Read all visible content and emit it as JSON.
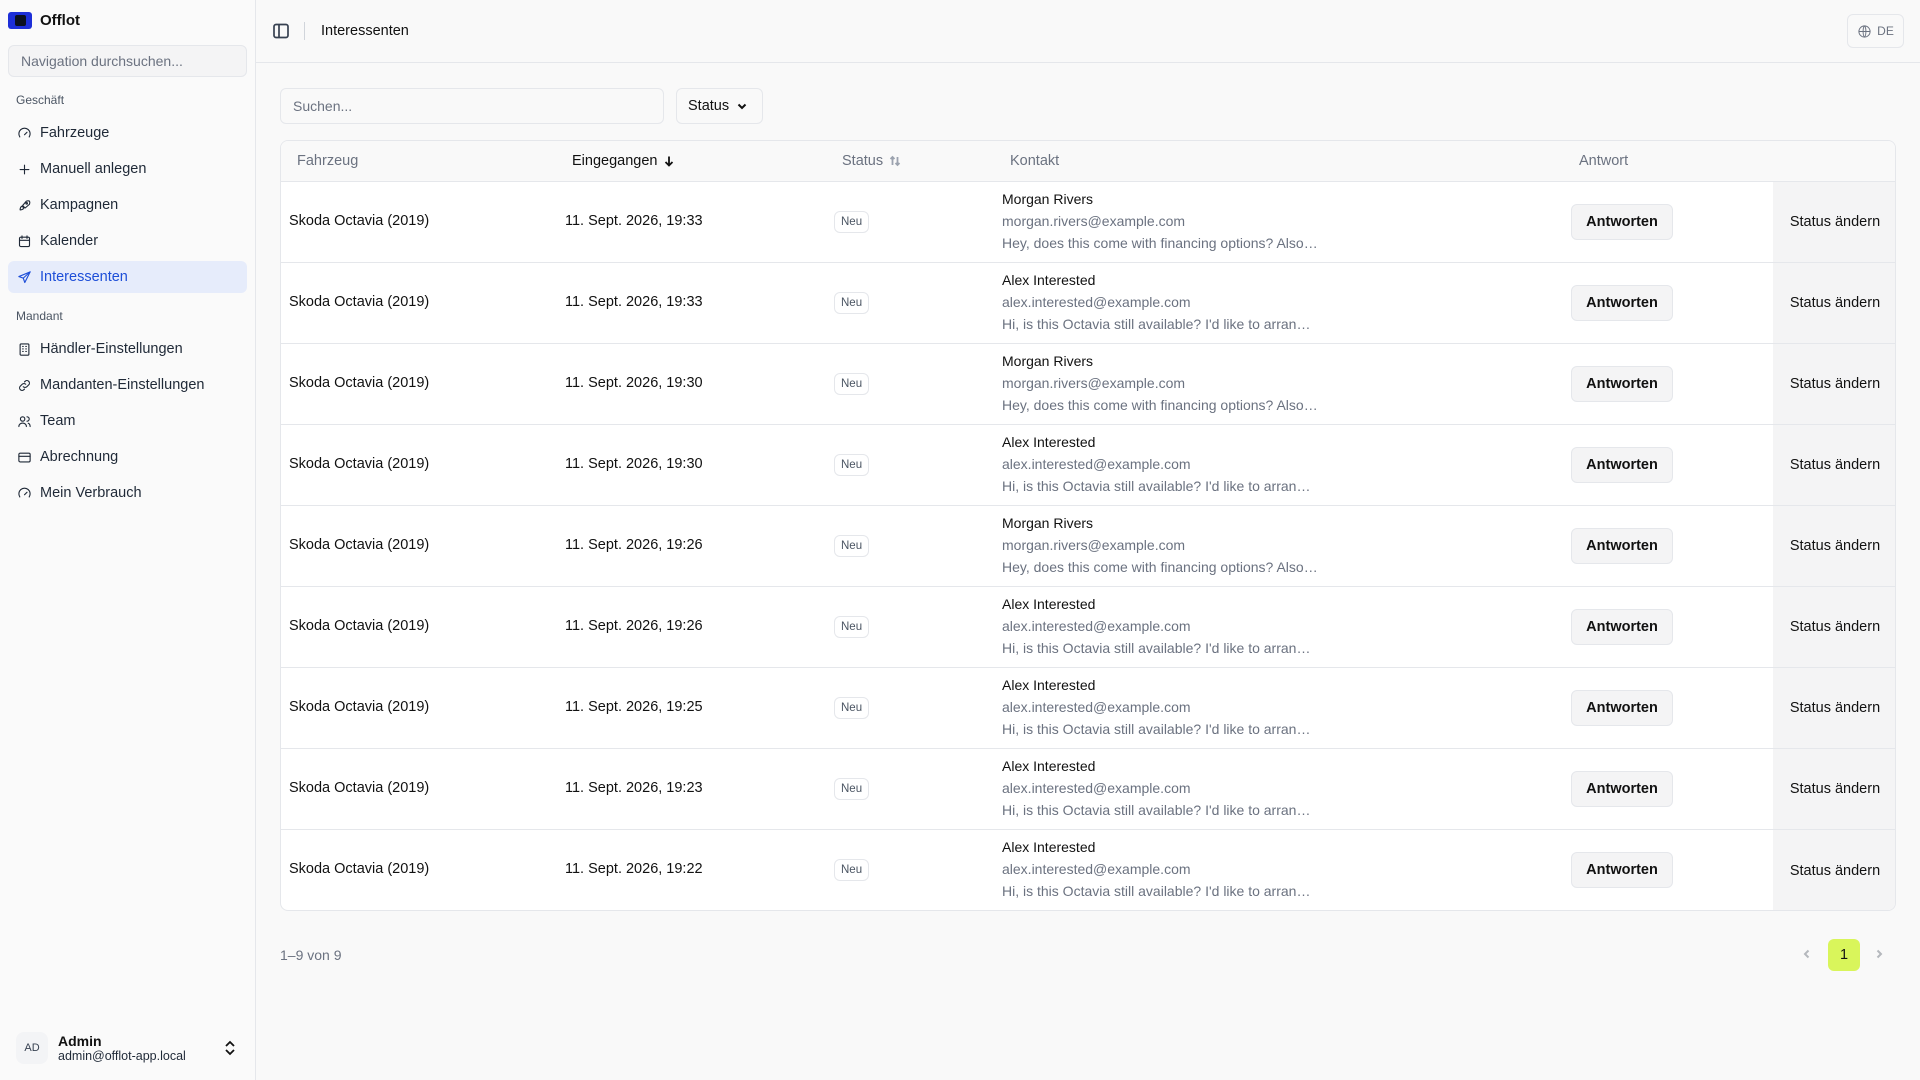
{
  "sidebar": {
    "brand": "Offlot",
    "search_placeholder": "Navigation durchsuchen...",
    "section_business": "Geschäft",
    "section_tenant": "Mandant",
    "items": [
      {
        "label": "Fahrzeuge",
        "icon": "gauge-icon"
      },
      {
        "label": "Manuell anlegen",
        "icon": "plus-icon"
      },
      {
        "label": "Kampagnen",
        "icon": "rocket-icon"
      },
      {
        "label": "Kalender",
        "icon": "calendar-icon"
      },
      {
        "label": "Interessenten",
        "icon": "send-icon",
        "active": true
      },
      {
        "label": "Händler-Einstellungen",
        "icon": "building-icon"
      },
      {
        "label": "Mandanten-Einstellungen",
        "icon": "link-icon"
      },
      {
        "label": "Team",
        "icon": "users-icon"
      },
      {
        "label": "Abrechnung",
        "icon": "credit-card-icon"
      },
      {
        "label": "Mein Verbrauch",
        "icon": "gauge-icon"
      }
    ],
    "user": {
      "initials": "AD",
      "name": "Admin",
      "email": "admin@offlot-app.local"
    }
  },
  "header": {
    "title": "Interessenten",
    "language": "DE"
  },
  "toolbar": {
    "search_placeholder": "Suchen...",
    "status_filter": "Status"
  },
  "table": {
    "columns": [
      "Fahrzeug",
      "Eingegangen",
      "Status",
      "Kontakt",
      "Antwort"
    ],
    "rows": [
      {
        "vehicle": "Skoda Octavia (2019)",
        "date": "11. Sept. 2026, 19:33",
        "status": "Neu",
        "name": "Morgan Rivers",
        "email": "morgan.rivers@example.com",
        "message": "Hey, does this come with financing options? Also is it available for a test drive?",
        "reply": "Antworten",
        "action": "Status ändern"
      },
      {
        "vehicle": "Skoda Octavia (2019)",
        "date": "11. Sept. 2026, 19:33",
        "status": "Neu",
        "name": "Alex Interested",
        "email": "alex.interested@example.com",
        "message": "Hi, is this Octavia still available? I'd like to arrange a viewing.",
        "reply": "Antworten",
        "action": "Status ändern"
      },
      {
        "vehicle": "Skoda Octavia (2019)",
        "date": "11. Sept. 2026, 19:30",
        "status": "Neu",
        "name": "Morgan Rivers",
        "email": "morgan.rivers@example.com",
        "message": "Hey, does this come with financing options? Also is it available for a test drive?",
        "reply": "Antworten",
        "action": "Status ändern"
      },
      {
        "vehicle": "Skoda Octavia (2019)",
        "date": "11. Sept. 2026, 19:30",
        "status": "Neu",
        "name": "Alex Interested",
        "email": "alex.interested@example.com",
        "message": "Hi, is this Octavia still available? I'd like to arrange a viewing.",
        "reply": "Antworten",
        "action": "Status ändern"
      },
      {
        "vehicle": "Skoda Octavia (2019)",
        "date": "11. Sept. 2026, 19:26",
        "status": "Neu",
        "name": "Morgan Rivers",
        "email": "morgan.rivers@example.com",
        "message": "Hey, does this come with financing options? Also is it available for a test drive?",
        "reply": "Antworten",
        "action": "Status ändern"
      },
      {
        "vehicle": "Skoda Octavia (2019)",
        "date": "11. Sept. 2026, 19:26",
        "status": "Neu",
        "name": "Alex Interested",
        "email": "alex.interested@example.com",
        "message": "Hi, is this Octavia still available? I'd like to arrange a viewing.",
        "reply": "Antworten",
        "action": "Status ändern"
      },
      {
        "vehicle": "Skoda Octavia (2019)",
        "date": "11. Sept. 2026, 19:25",
        "status": "Neu",
        "name": "Alex Interested",
        "email": "alex.interested@example.com",
        "message": "Hi, is this Octavia still available? I'd like to arrange a viewing.",
        "reply": "Antworten",
        "action": "Status ändern"
      },
      {
        "vehicle": "Skoda Octavia (2019)",
        "date": "11. Sept. 2026, 19:23",
        "status": "Neu",
        "name": "Alex Interested",
        "email": "alex.interested@example.com",
        "message": "Hi, is this Octavia still available? I'd like to arrange a viewing.",
        "reply": "Antworten",
        "action": "Status ändern"
      },
      {
        "vehicle": "Skoda Octavia (2019)",
        "date": "11. Sept. 2026, 19:22",
        "status": "Neu",
        "name": "Alex Interested",
        "email": "alex.interested@example.com",
        "message": "Hi, is this Octavia still available? I'd like to arrange a viewing.",
        "reply": "Antworten",
        "action": "Status ändern"
      }
    ]
  },
  "footer": {
    "count": "1–9 von 9",
    "page": "1"
  },
  "colors": {
    "active_nav_bg": "#e6ecfb",
    "active_nav_text": "#1d4ed8",
    "page_active": "#d9f55b",
    "brand": "#1d2fd8"
  }
}
